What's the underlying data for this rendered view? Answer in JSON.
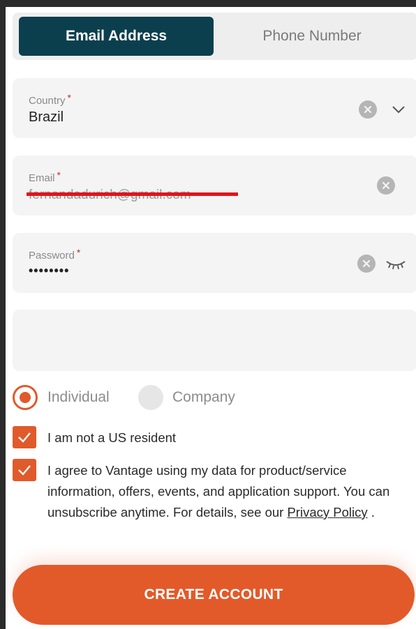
{
  "tabs": {
    "email_label": "Email Address",
    "phone_label": "Phone Number",
    "active": "email"
  },
  "country": {
    "label": "Country",
    "required_mark": "*",
    "value": "Brazil"
  },
  "email": {
    "label": "Email",
    "required_mark": "*",
    "value": "fernandadurich@gmail.com",
    "redacted": true
  },
  "password": {
    "label": "Password",
    "required_mark": "*",
    "value": "••••••••"
  },
  "account_type": {
    "options": [
      "Individual",
      "Company"
    ],
    "selected": "Individual"
  },
  "checkboxes": {
    "us_resident": {
      "label": "I am not a US resident",
      "checked": true
    },
    "consent": {
      "label_main": "I agree to Vantage using my data for product/service information, offers, events, and application support. You can unsubscribe anytime. For details, see our ",
      "link_text": "Privacy Policy",
      "label_end": " .",
      "checked": true
    }
  },
  "cta": {
    "label": "CREATE ACCOUNT"
  },
  "colors": {
    "accent": "#e25a2a",
    "tab_active": "#0c3f4e",
    "field_bg": "#f4f4f4",
    "redaction": "#e0141c"
  },
  "icons": [
    "clear-icon",
    "chevron-down-icon",
    "eye-closed-icon",
    "check-icon"
  ]
}
